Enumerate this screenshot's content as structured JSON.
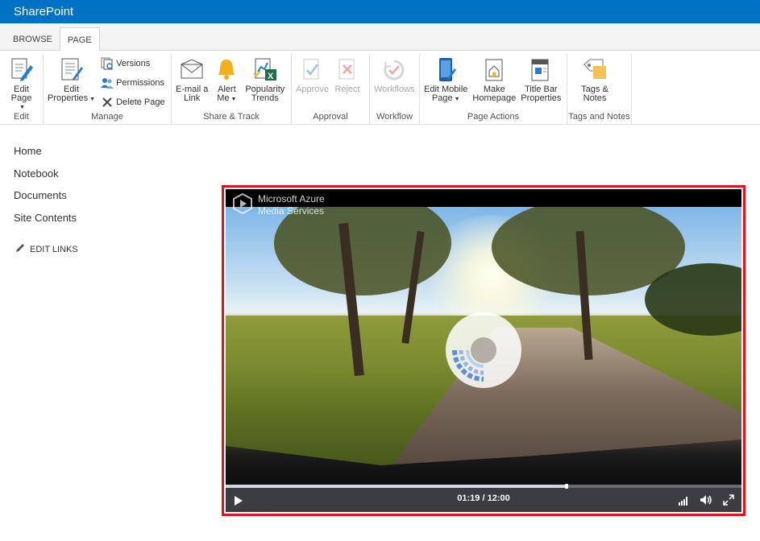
{
  "app": {
    "title": "SharePoint"
  },
  "tabs": [
    {
      "label": "BROWSE",
      "active": false
    },
    {
      "label": "PAGE",
      "active": true
    }
  ],
  "ribbon": {
    "edit": {
      "title": "Edit",
      "edit_page": "Edit Page"
    },
    "manage": {
      "title": "Manage",
      "edit_properties_1": "Edit",
      "edit_properties_2": "Properties",
      "versions": "Versions",
      "permissions": "Permissions",
      "delete_page": "Delete Page"
    },
    "share": {
      "title": "Share & Track",
      "email_1": "E-mail a",
      "email_2": "Link",
      "alert_1": "Alert",
      "alert_2": "Me",
      "popularity_1": "Popularity",
      "popularity_2": "Trends"
    },
    "approval": {
      "title": "Approval",
      "approve": "Approve",
      "reject": "Reject"
    },
    "workflow": {
      "title": "Workflow",
      "workflows": "Workflows"
    },
    "page_actions": {
      "title": "Page Actions",
      "mobile_1": "Edit Mobile",
      "mobile_2": "Page",
      "homepage_1": "Make",
      "homepage_2": "Homepage",
      "titlebar_1": "Title Bar",
      "titlebar_2": "Properties"
    },
    "tags": {
      "title": "Tags and Notes",
      "tags_1": "Tags &",
      "tags_2": "Notes"
    }
  },
  "leftnav": {
    "items": [
      "Home",
      "Notebook",
      "Documents",
      "Site Contents"
    ],
    "edit_links": "EDIT LINKS"
  },
  "video": {
    "brand_line1": "Microsoft Azure",
    "brand_line2": "Media Services",
    "time": "01:19 / 12:00",
    "progress": 0.658,
    "colors": {
      "accent_border": "#e0141e",
      "suitebar": "#0072c6"
    }
  }
}
